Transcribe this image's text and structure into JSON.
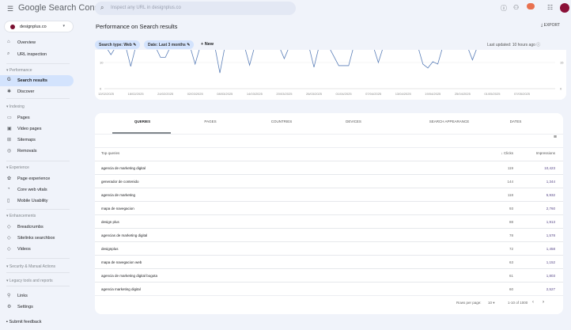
{
  "header": {
    "app_title": "Google Search Console",
    "search_placeholder": "Inspect any URL in designplus.co"
  },
  "property": {
    "name": "designplus.co"
  },
  "sidebar": {
    "top": [
      {
        "label": "Overview",
        "icon": "home"
      },
      {
        "label": "URL inspection",
        "icon": "search"
      }
    ],
    "sections": [
      {
        "title": "Performance",
        "items": [
          {
            "label": "Search results",
            "icon": "google-g",
            "active": true
          },
          {
            "label": "Discover",
            "icon": "asterisk"
          }
        ]
      },
      {
        "title": "Indexing",
        "items": [
          {
            "label": "Pages",
            "icon": "pages"
          },
          {
            "label": "Video pages",
            "icon": "video"
          },
          {
            "label": "Sitemaps",
            "icon": "sitemap"
          },
          {
            "label": "Removals",
            "icon": "eye-off"
          }
        ]
      },
      {
        "title": "Experience",
        "items": [
          {
            "label": "Page experience",
            "icon": "gear-plus"
          },
          {
            "label": "Core web vitals",
            "icon": "gauge"
          },
          {
            "label": "Mobile Usability",
            "icon": "phone"
          }
        ]
      },
      {
        "title": "Enhancements",
        "items": [
          {
            "label": "Breadcrumbs",
            "icon": "diamond"
          },
          {
            "label": "Sitelinks searchbox",
            "icon": "diamond"
          },
          {
            "label": "Videos",
            "icon": "diamond"
          }
        ]
      },
      {
        "title": "Security & Manual Actions",
        "items": []
      },
      {
        "title": "Legacy tools and reports",
        "items": []
      }
    ],
    "bottom": [
      {
        "label": "Links",
        "icon": "links"
      },
      {
        "label": "Settings",
        "icon": "settings"
      }
    ],
    "feedback": "Submit feedback"
  },
  "page": {
    "title": "Performance on Search results",
    "export": "EXPORT",
    "filters": [
      "Search type: Web",
      "Date: Last 3 months"
    ],
    "new": "New",
    "last_updated": "Last updated: 10 hours ago"
  },
  "chart_data": {
    "type": "line",
    "x_ticks": [
      "12/02/2025",
      "18/02/2025",
      "24/02/2025",
      "02/03/2025",
      "08/03/2025",
      "14/03/2025",
      "20/03/2025",
      "26/03/2025",
      "01/04/2025",
      "07/04/2025",
      "13/04/2025",
      "19/04/2025",
      "25/04/2025",
      "01/05/2025",
      "07/05/2025"
    ],
    "y_left_ticks": [
      "0",
      "10"
    ],
    "y_right_ticks": [
      "0",
      "15"
    ],
    "color": "#5b7fb8",
    "points": [
      [
        "12/02/2025",
        16
      ],
      [
        "13/02/2025",
        13
      ],
      [
        "14/02/2025",
        16
      ],
      [
        "16/02/2025",
        16
      ],
      [
        "17/02/2025",
        8.5
      ],
      [
        "18/02/2025",
        16
      ],
      [
        "22/02/2025",
        16
      ],
      [
        "23/02/2025",
        12
      ],
      [
        "24/02/2025",
        12
      ],
      [
        "25/02/2025",
        16
      ],
      [
        "01/03/2025",
        16
      ],
      [
        "02/03/2025",
        9.4
      ],
      [
        "03/03/2025",
        16
      ],
      [
        "06/03/2025",
        16
      ],
      [
        "07/03/2025",
        6
      ],
      [
        "08/03/2025",
        16
      ],
      [
        "12/03/2025",
        16
      ],
      [
        "13/03/2025",
        9
      ],
      [
        "14/03/2025",
        16
      ],
      [
        "19/03/2025",
        16
      ],
      [
        "20/03/2025",
        11.5
      ],
      [
        "21/03/2025",
        16
      ],
      [
        "25/03/2025",
        16
      ],
      [
        "26/03/2025",
        8.2
      ],
      [
        "27/03/2025",
        16
      ],
      [
        "29/03/2025",
        16
      ],
      [
        "31/03/2025",
        8.8
      ],
      [
        "02/04/2025",
        8.8
      ],
      [
        "03/04/2025",
        16
      ],
      [
        "07/04/2025",
        16
      ],
      [
        "08/04/2025",
        10
      ],
      [
        "09/04/2025",
        16
      ],
      [
        "16/04/2025",
        16
      ],
      [
        "17/04/2025",
        9.4
      ],
      [
        "18/04/2025",
        7.9
      ],
      [
        "19/04/2025",
        10.3
      ],
      [
        "20/04/2025",
        9.4
      ],
      [
        "21/04/2025",
        16
      ],
      [
        "26/04/2025",
        16
      ],
      [
        "27/04/2025",
        11
      ],
      [
        "28/04/2025",
        16
      ]
    ],
    "ylim": [
      0,
      15
    ]
  },
  "tabs": [
    "QUERIES",
    "PAGES",
    "COUNTRIES",
    "DEVICES",
    "SEARCH APPEARANCE",
    "DATES"
  ],
  "table": {
    "headers": {
      "query": "Top queries",
      "clicks": "Clicks",
      "impressions": "Impressions"
    },
    "rows": [
      {
        "query": "agencia de marketing digital",
        "clicks": "119",
        "impressions": "10,423"
      },
      {
        "query": "generador de contenido",
        "clicks": "144",
        "impressions": "1,344"
      },
      {
        "query": "agencia de marketing",
        "clicks": "118",
        "impressions": "5,932"
      },
      {
        "query": "mapa de navegacion",
        "clicks": "93",
        "impressions": "2,760"
      },
      {
        "query": "design plus",
        "clicks": "88",
        "impressions": "1,913"
      },
      {
        "query": "agencias de marketing digital",
        "clicks": "78",
        "impressions": "1,578"
      },
      {
        "query": "designplus",
        "clicks": "72",
        "impressions": "1,458"
      },
      {
        "query": "mapa de navegacion web",
        "clicks": "63",
        "impressions": "1,152"
      },
      {
        "query": "agencia de marketing digital bogota",
        "clicks": "61",
        "impressions": "1,803"
      },
      {
        "query": "agencia marketing digital",
        "clicks": "60",
        "impressions": "2,527"
      }
    ]
  },
  "pagination": {
    "rows_label": "Rows per page:",
    "rows_value": "10",
    "range": "1-10 of 1000"
  }
}
